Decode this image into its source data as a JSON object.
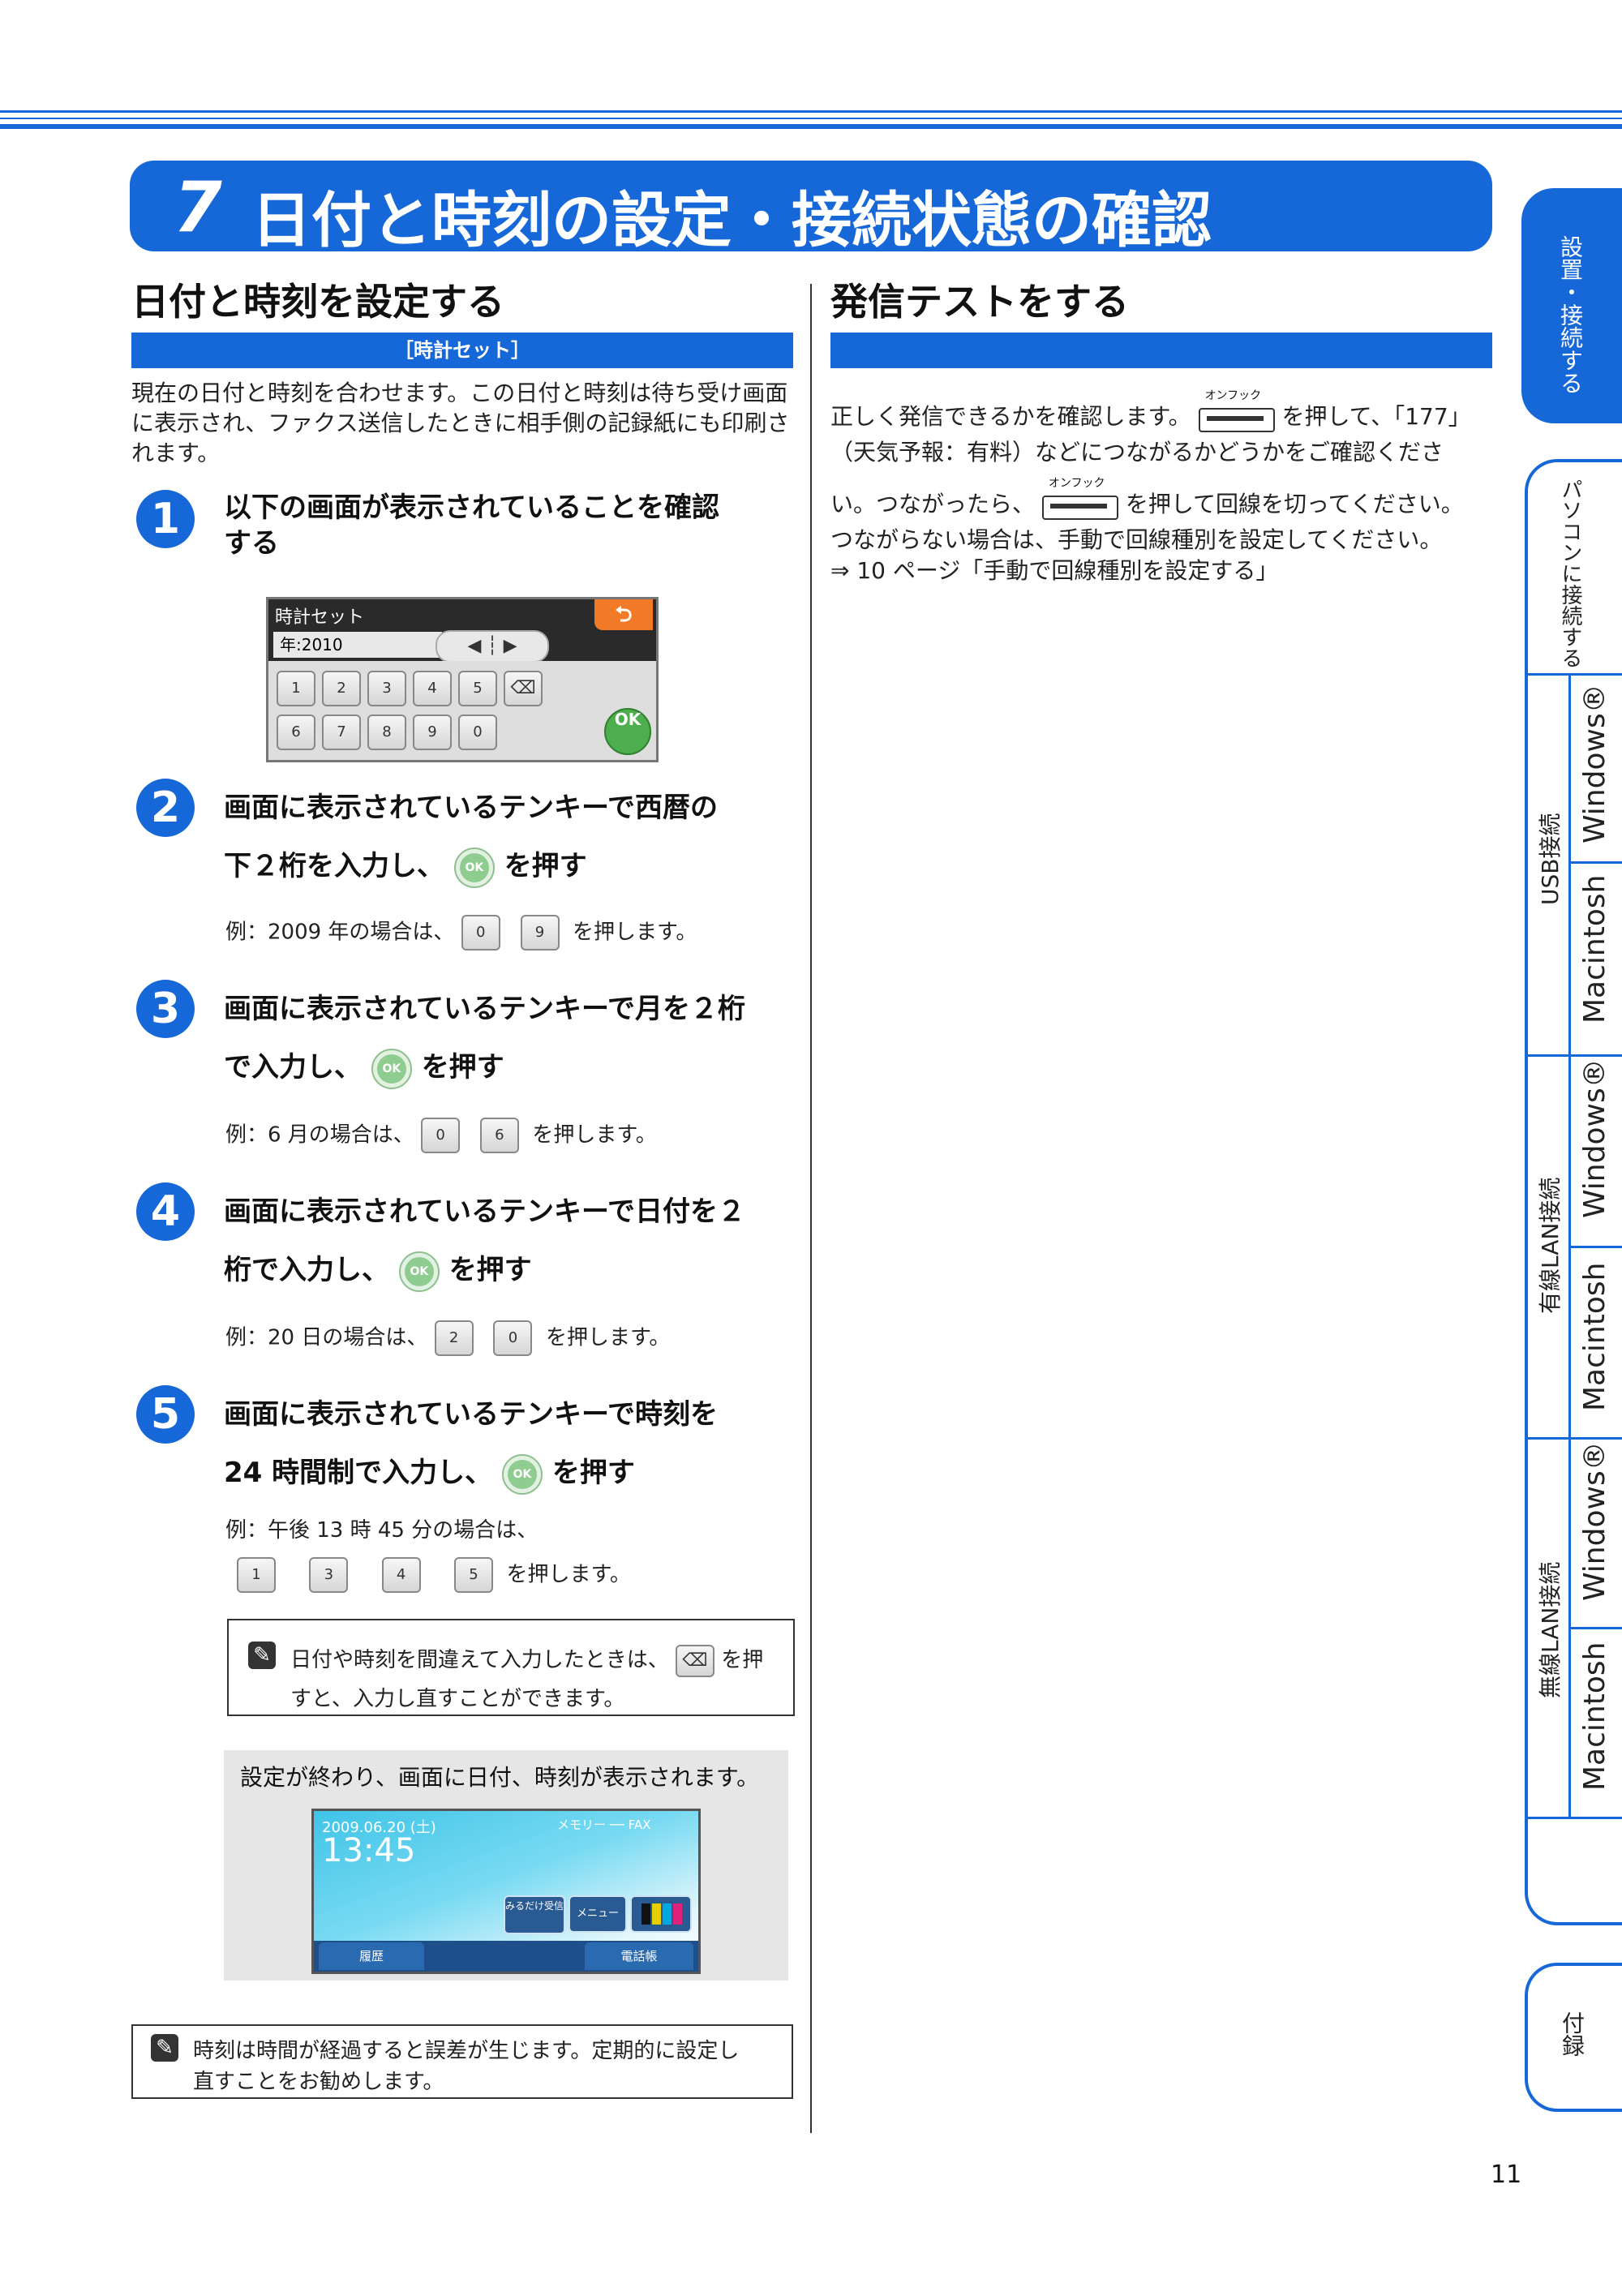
{
  "banner": {
    "num": "7",
    "title": "日付と時刻の設定・接続状態の確認"
  },
  "left": {
    "heading": "日付と時刻を設定する",
    "bar_label": "［時計セット］",
    "intro": "現在の日付と時刻を合わせます。この日付と時刻は待ち受け画面に表示され、ファクス送信したときに相手側の記録紙にも印刷されます。",
    "steps": [
      {
        "num": "1",
        "line1": "以下の画面が表示されていることを確認",
        "line2": "する"
      },
      {
        "num": "2",
        "line1": "画面に表示されているテンキーで西暦の",
        "line2a": "下２桁を入力し、",
        "line2b": "を押す",
        "ex_pre": "例：2009 年の場合は、",
        "keys": [
          "0",
          "9"
        ],
        "ex_post": "を押します。"
      },
      {
        "num": "3",
        "line1": "画面に表示されているテンキーで月を２桁",
        "line2a": "で入力し、",
        "line2b": "を押す",
        "ex_pre": "例：6 月の場合は、",
        "keys": [
          "0",
          "6"
        ],
        "ex_post": "を押します。"
      },
      {
        "num": "4",
        "line1": "画面に表示されているテンキーで日付を２",
        "line2a": "桁で入力し、",
        "line2b": "を押す",
        "ex_pre": "例：20 日の場合は、",
        "keys": [
          "2",
          "0"
        ],
        "ex_post": "を押します。"
      },
      {
        "num": "5",
        "line1": "画面に表示されているテンキーで時刻を",
        "line2a": "24 時間制で入力し、",
        "line2b": "を押す",
        "ex_pre": "例：午後 13 時 45 分の場合は、",
        "keys": [
          "1",
          "3",
          "4",
          "5"
        ],
        "ex_post": "を押します。"
      }
    ],
    "ok_label": "OK",
    "note1_a": "日付や時刻を間違えて入力したときは、",
    "note1_b": "を押",
    "note1_c": "すと、入力し直すことができます。",
    "done_text": "設定が終わり、画面に日付、時刻が表示されます。",
    "note2_a": "時刻は時間が経過すると誤差が生じます。定期的に設定し",
    "note2_b": "直すことをお勧めします。"
  },
  "lcd1": {
    "title": "時計セット",
    "field": "年:2010",
    "keys_row1": [
      "1",
      "2",
      "3",
      "4",
      "5"
    ],
    "keys_row2": [
      "6",
      "7",
      "8",
      "9",
      "0"
    ],
    "ok": "OK"
  },
  "lcd2": {
    "date": "2009.06.20 (土)",
    "time": "13:45",
    "status": "メモリー ── FAX",
    "btn1": "みるだけ受信",
    "btn2": "メニュー",
    "tab1": "履歴",
    "tab2": "電話帳"
  },
  "right": {
    "heading": "発信テストをする",
    "p1_a": "正しく発信できるかを確認します。",
    "p1_b": "を押して、「177」",
    "p2": "（天気予報：有料）などにつながるかどうかをご確認くださ",
    "p3_a": "い。つながったら、",
    "p3_b": "を押して回線を切ってください。",
    "p4": "つながらない場合は、手動で回線種別を設定してください。",
    "p5": "⇒ 10 ページ「手動で回線種別を設定する」",
    "onhook": "オンフック"
  },
  "sidebar": {
    "tab1": "設置・接続する",
    "tab2": "パソコンに接続する",
    "usb": "USB接続",
    "wired": "有線LAN接続",
    "wireless": "無線LAN接続",
    "windows": "Windows®",
    "mac": "Macintosh",
    "appendix": "付録"
  },
  "page_number": "11",
  "colors": {
    "accent": "#1668d8",
    "ok_green": "#4cae4c",
    "lcd_orange": "#f07a28"
  }
}
